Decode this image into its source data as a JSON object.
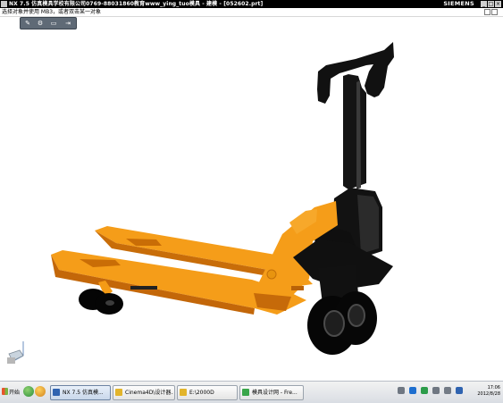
{
  "window": {
    "title": "NX 7.5 仿真模具学校有限公司0769-88031860教育www_ying_tuo模具 - 建模 - [052602.prt]",
    "brand": "SIEMENS",
    "buttons": {
      "minimize": "_",
      "maximize": "□",
      "close": "×"
    }
  },
  "status": {
    "prompt": "选择对象并使用 MB3，或者双击某一对象"
  },
  "toolbar": {
    "items": [
      "✎",
      "⚙",
      "▭",
      "⇥"
    ]
  },
  "taskbar": {
    "start_label": "开始",
    "tasks": [
      {
        "label": "NX 7.5 仿真模...",
        "icon_color": "#2f63b0"
      },
      {
        "label": "Cinema4D\\设计器...",
        "icon_color": "#e2b42b"
      },
      {
        "label": "E:\\2000D",
        "icon_color": "#e2b42b"
      },
      {
        "label": "模具设计网 - Fre...",
        "icon_color": "#3aa64a"
      }
    ],
    "clock_time": "17:06",
    "clock_date": "2012/8/28"
  }
}
